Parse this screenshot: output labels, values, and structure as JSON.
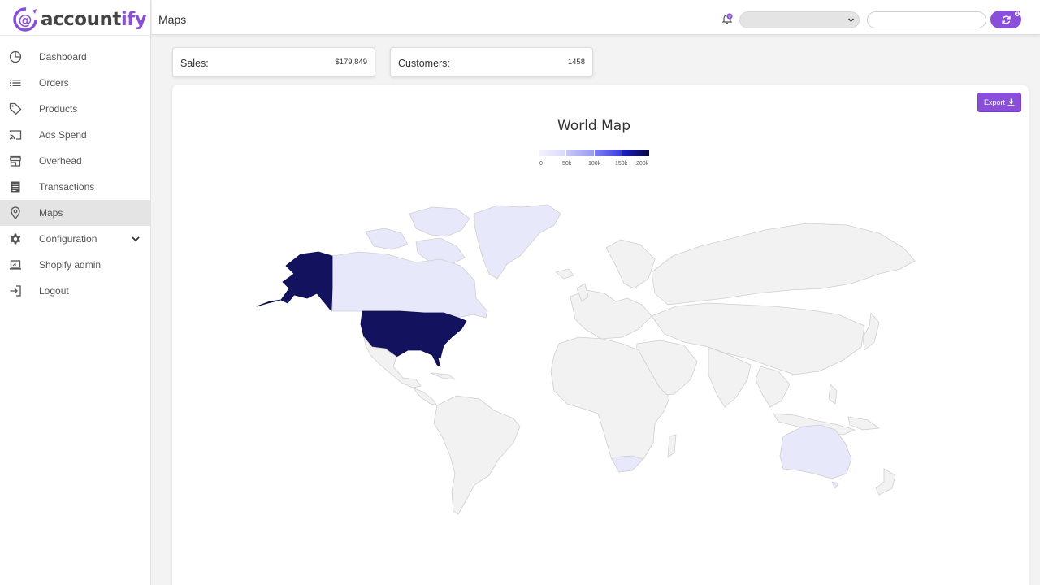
{
  "brand": {
    "name_part1": "account",
    "name_part2": "ify",
    "accent_color": "#8a4fd8"
  },
  "sidebar": {
    "items": [
      {
        "label": "Dashboard",
        "icon": "pie-chart-icon"
      },
      {
        "label": "Orders",
        "icon": "list-icon"
      },
      {
        "label": "Products",
        "icon": "tag-icon"
      },
      {
        "label": "Ads Spend",
        "icon": "cast-icon"
      },
      {
        "label": "Overhead",
        "icon": "store-icon"
      },
      {
        "label": "Transactions",
        "icon": "document-icon"
      },
      {
        "label": "Maps",
        "icon": "map-pin-icon",
        "active": true
      },
      {
        "label": "Configuration",
        "icon": "gear-icon",
        "expandable": true
      },
      {
        "label": "Shopify admin",
        "icon": "laptop-icon"
      },
      {
        "label": "Logout",
        "icon": "logout-icon"
      }
    ]
  },
  "header": {
    "title": "Maps",
    "notification_count": "0",
    "store_select_value": "",
    "search_value": "",
    "sync_badge": "1"
  },
  "stats": {
    "sales_label": "Sales:",
    "sales_value": "$179,849",
    "customers_label": "Customers:",
    "customers_value": "1458"
  },
  "map": {
    "title": "World Map",
    "export_label": "Export",
    "legend": {
      "ticks": [
        "0",
        "50k",
        "100k",
        "150k",
        "200k"
      ],
      "colors": [
        "#ebebfc",
        "#b7b7f7",
        "#7a7af0",
        "#2222d8",
        "#0a0a3a"
      ]
    },
    "regions": [
      {
        "name": "United States",
        "color": "#12125f",
        "level": "high"
      },
      {
        "name": "Canada",
        "color": "#e8e8fb",
        "level": "low"
      },
      {
        "name": "Australia",
        "color": "#e8e8fb",
        "level": "low"
      },
      {
        "name": "South Africa",
        "color": "#e8e8fb",
        "level": "low"
      },
      {
        "name": "Greenland",
        "color": "#e8e8fb",
        "level": "low"
      }
    ],
    "default_land_color": "#f2f2f2"
  }
}
